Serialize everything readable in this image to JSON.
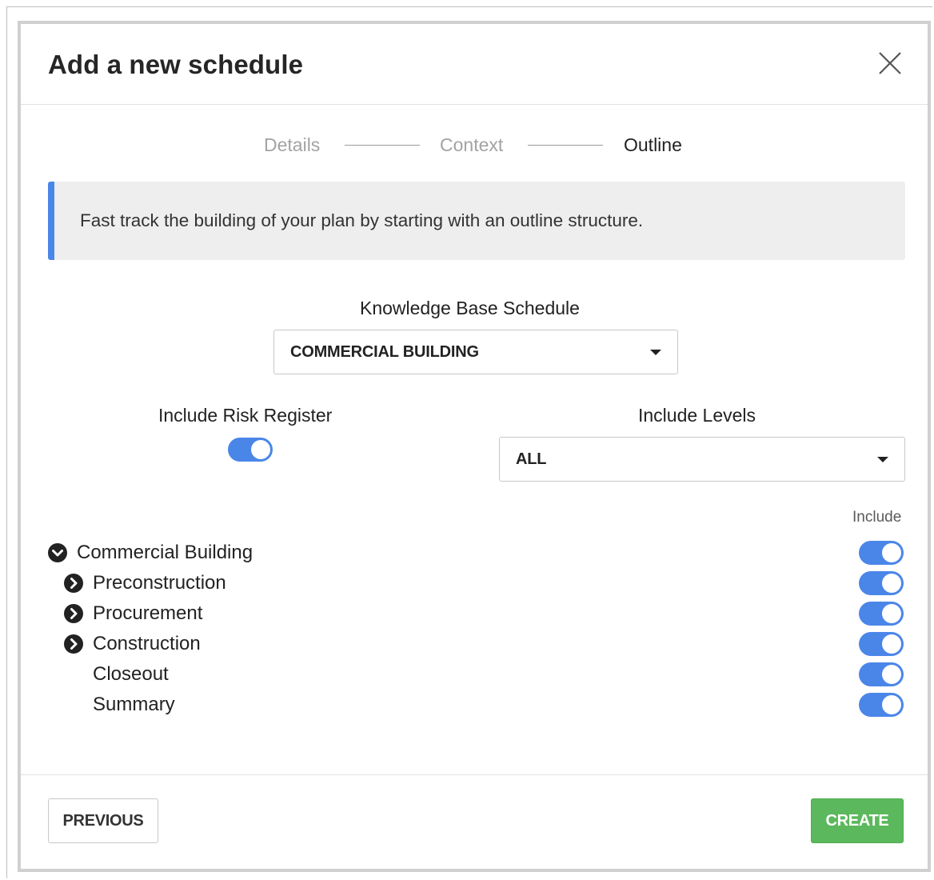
{
  "modal": {
    "title": "Add a new schedule"
  },
  "steps": [
    {
      "label": "Details",
      "state": "complete"
    },
    {
      "label": "Context",
      "state": "complete"
    },
    {
      "label": "Outline",
      "state": "active"
    }
  ],
  "info": {
    "text": "Fast track the building of your plan by starting with an outline structure.",
    "accent_color": "#4a86e8"
  },
  "knowledge_base": {
    "label": "Knowledge Base Schedule",
    "selected": "COMMERCIAL BUILDING"
  },
  "risk_register": {
    "label": "Include Risk Register",
    "enabled": true
  },
  "levels": {
    "label": "Include Levels",
    "selected": "ALL"
  },
  "outline": {
    "include_header": "Include",
    "items": [
      {
        "label": "Commercial Building",
        "expander": "chevron-down-circle-icon",
        "included": true
      },
      {
        "label": "Preconstruction",
        "expander": "chevron-right-circle-icon",
        "included": true
      },
      {
        "label": "Procurement",
        "expander": "chevron-right-circle-icon",
        "included": true
      },
      {
        "label": "Construction",
        "expander": "chevron-right-circle-icon",
        "included": true
      },
      {
        "label": "Closeout",
        "expander": "",
        "included": true
      },
      {
        "label": "Summary",
        "expander": "",
        "included": true
      }
    ]
  },
  "footer": {
    "previous_label": "PREVIOUS",
    "create_label": "CREATE",
    "create_color": "#5cb85c"
  },
  "colors": {
    "toggle_on": "#4a86e8"
  }
}
